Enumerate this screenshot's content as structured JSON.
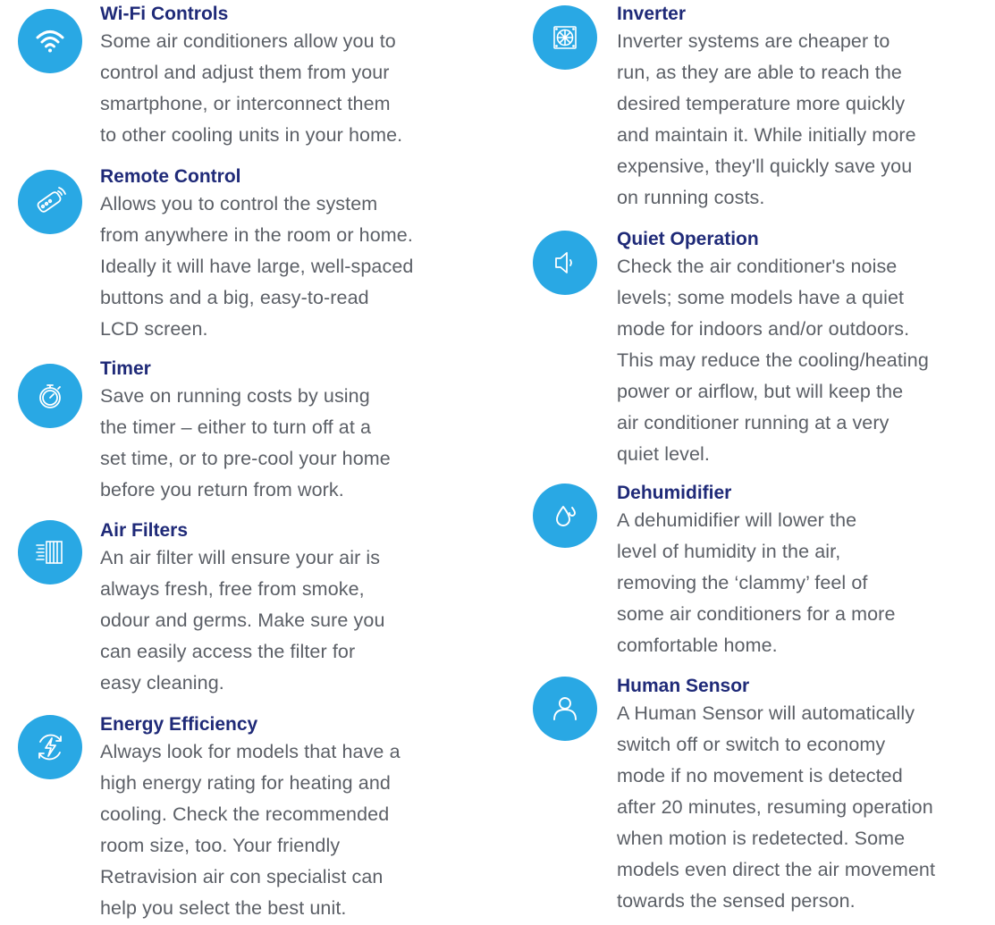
{
  "left_column": [
    {
      "icon": "wifi-icon",
      "title": "Wi-Fi Controls",
      "lines": [
        "Some air conditioners allow you to",
        "control and adjust them from your",
        "smartphone, or interconnect them",
        "to other cooling units in your home."
      ]
    },
    {
      "icon": "remote-control-icon",
      "title": "Remote Control",
      "lines": [
        "Allows you to control the system",
        "from anywhere in the room or home.",
        "Ideally it will have large, well-spaced",
        "buttons and a big, easy-to-read",
        "LCD screen."
      ]
    },
    {
      "icon": "stopwatch-icon",
      "title": "Timer",
      "lines": [
        "Save on running costs by using",
        "the timer – either to turn off at a",
        "set time, or to pre-cool your home",
        "before you return from work."
      ]
    },
    {
      "icon": "air-filter-icon",
      "title": "Air Filters",
      "lines": [
        "An air filter will ensure your air is",
        "always fresh, free from smoke,",
        "odour and germs. Make sure you",
        "can easily access the filter for",
        "easy cleaning."
      ]
    },
    {
      "icon": "energy-efficiency-icon",
      "title": "Energy Efficiency",
      "lines": [
        "Always look for models that have a",
        "high energy rating for heating and",
        "cooling. Check the recommended",
        "room size, too. Your friendly",
        "Retravision air con specialist can",
        "help you select the best unit."
      ]
    }
  ],
  "right_column": [
    {
      "icon": "inverter-fan-icon",
      "title": "Inverter",
      "lines": [
        "Inverter systems are cheaper to",
        "run, as they are able to reach the",
        "desired temperature more quickly",
        "and maintain it. While initially more",
        "expensive, they'll quickly save you",
        "on running costs."
      ]
    },
    {
      "icon": "speaker-quiet-icon",
      "title": "Quiet Operation",
      "lines": [
        "Check the air conditioner's noise",
        "levels; some models have a quiet",
        "mode for indoors and/or outdoors.",
        "This may reduce the cooling/heating",
        "power or airflow, but will keep the",
        "air conditioner running at a very",
        "quiet level."
      ]
    },
    {
      "icon": "water-drops-icon",
      "title": "Dehumidifier",
      "lines": [
        "A dehumidifier will lower the",
        "level of humidity in the air,",
        "removing the ‘clammy’ feel of",
        "some air conditioners for a more",
        "comfortable home."
      ]
    },
    {
      "icon": "person-icon",
      "title": "Human Sensor",
      "lines": [
        "A Human Sensor will automatically",
        "switch off or switch to economy",
        "mode if no movement is detected",
        "after 20 minutes, resuming operation",
        "when motion is redetected. Some",
        "models even direct the air movement",
        "towards the sensed person."
      ]
    }
  ],
  "colors": {
    "icon_background": "#29a8e4",
    "heading": "#1f2a78",
    "body_text": "#5b5f66"
  }
}
